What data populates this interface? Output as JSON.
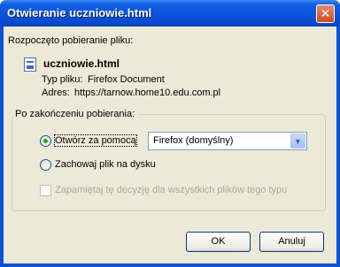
{
  "window": {
    "title": "Otwieranie uczniowie.html",
    "close_glyph": "✕"
  },
  "intro": "Rozpoczęto pobieranie pliku:",
  "file": {
    "icon": "html-file-icon",
    "name": "uczniowie.html",
    "type_label": "Typ pliku:",
    "type_value": "Firefox Document",
    "address_label": "Adres:",
    "address_value": "https://tarnow.home10.edu.com.pl"
  },
  "group": {
    "legend": "Po zakończeniu pobierania:",
    "open_with_label": "Otwórz za pomocą",
    "open_with_selected": true,
    "app_select_value": "Firefox (domyślny)",
    "save_label": "Zachowaj plik na dysku",
    "save_selected": false,
    "remember_label": "Zapamiętaj tę decyzję dla wszystkich plików tego typu",
    "remember_checked": false,
    "remember_enabled": false
  },
  "buttons": {
    "ok": "OK",
    "cancel": "Anuluj"
  },
  "colors": {
    "title_bar": "#0a53db",
    "dialog_bg": "#ece9d8",
    "radio_dot": "#2b9d2b"
  }
}
